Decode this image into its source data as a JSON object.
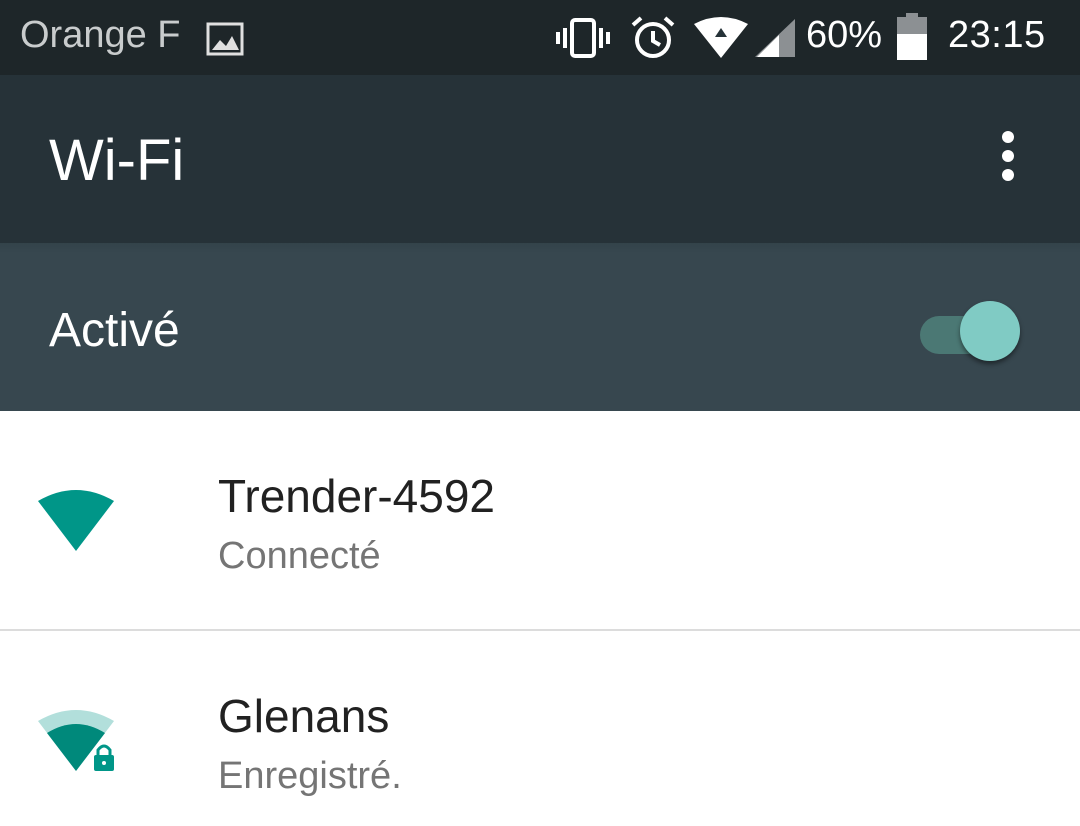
{
  "status_bar": {
    "carrier": "Orange F",
    "battery_percent": "60%",
    "battery_level": 0.6,
    "time": "23:15",
    "icons": [
      "gallery-icon",
      "vibrate-icon",
      "alarm-icon",
      "wifi-icon",
      "cell-signal-icon",
      "battery-icon"
    ]
  },
  "app_bar": {
    "title": "Wi-Fi",
    "menu_icon": "overflow-menu-icon"
  },
  "switch_bar": {
    "label": "Activé",
    "enabled": true
  },
  "networks": [
    {
      "name": "Trender-4592",
      "status": "Connecté",
      "icon": "wifi-full-icon",
      "signal_level": 4,
      "locked": false
    },
    {
      "name": "Glenans",
      "status": "Enregistré.",
      "icon": "wifi-locked-icon",
      "signal_level": 3,
      "locked": true
    }
  ],
  "colors": {
    "accent": "#009688",
    "accent_light": "#80cbc4",
    "app_bar": "#263238",
    "switch_bar": "#37474f",
    "status_bar": "#1e2629"
  }
}
